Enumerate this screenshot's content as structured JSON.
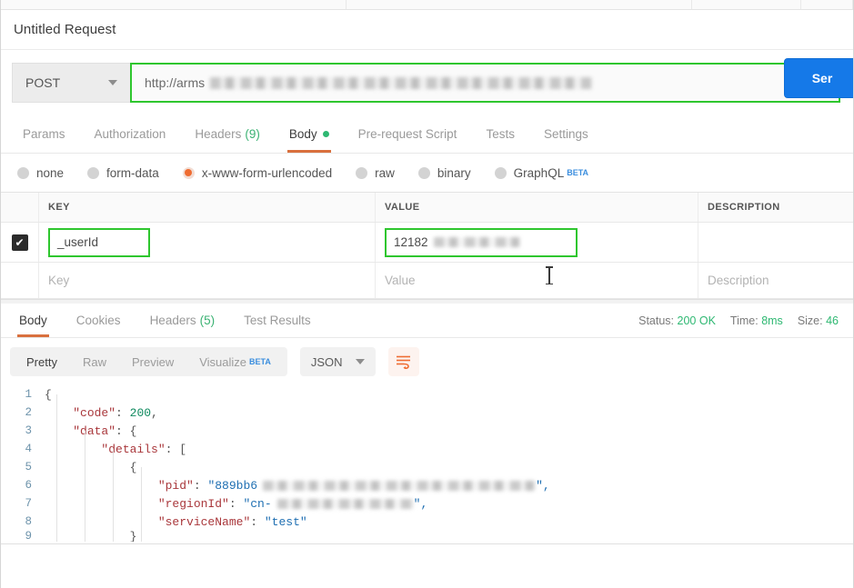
{
  "window": {
    "request_title": "Untitled Request"
  },
  "url_bar": {
    "method": "POST",
    "method_caret_icon": "chevron-down-icon",
    "url_value": "http://arms",
    "url_redacted": true,
    "send_label": "Send",
    "send_label_visible": "Ser",
    "highlight_color": "#2ec62e",
    "send_color": "#1579e8"
  },
  "request_tabs": [
    {
      "label": "Params",
      "active": false
    },
    {
      "label": "Authorization",
      "active": false
    },
    {
      "label": "Headers",
      "count": "(9)",
      "active": false
    },
    {
      "label": "Body",
      "active": true,
      "dot": true
    },
    {
      "label": "Pre-request Script",
      "active": false
    },
    {
      "label": "Tests",
      "active": false
    },
    {
      "label": "Settings",
      "active": false
    }
  ],
  "body_types": [
    {
      "label": "none",
      "selected": false
    },
    {
      "label": "form-data",
      "selected": false
    },
    {
      "label": "x-www-form-urlencoded",
      "selected": true
    },
    {
      "label": "raw",
      "selected": false
    },
    {
      "label": "binary",
      "selected": false
    },
    {
      "label": "GraphQL",
      "selected": false,
      "badge": "BETA"
    }
  ],
  "kv_table": {
    "columns": [
      "KEY",
      "VALUE",
      "DESCRIPTION"
    ],
    "rows": [
      {
        "checked": true,
        "check_icon": "checkmark-icon",
        "key": "_userId",
        "value": "12182",
        "value_redacted": true,
        "description": ""
      }
    ],
    "placeholders": {
      "key": "Key",
      "value": "Value",
      "description": "Description"
    }
  },
  "response": {
    "tabs": [
      {
        "label": "Body",
        "active": true
      },
      {
        "label": "Cookies",
        "active": false
      },
      {
        "label": "Headers",
        "count": "(5)",
        "active": false
      },
      {
        "label": "Test Results",
        "active": false
      }
    ],
    "meta": {
      "status_label": "Status:",
      "status_value": "200 OK",
      "time_label": "Time:",
      "time_value": "8ms",
      "size_label": "Size:",
      "size_value": "46"
    },
    "viewer": {
      "modes": [
        {
          "label": "Pretty",
          "active": true
        },
        {
          "label": "Raw",
          "active": false
        },
        {
          "label": "Preview",
          "active": false
        },
        {
          "label": "Visualize",
          "active": false,
          "badge": "BETA"
        }
      ],
      "format": "JSON",
      "format_caret_icon": "chevron-down-icon",
      "wrap_icon": "word-wrap-icon"
    },
    "json_lines": [
      {
        "no": "1",
        "indent": 0,
        "parts": [
          {
            "t": "{",
            "c": "p"
          }
        ]
      },
      {
        "no": "2",
        "indent": 1,
        "parts": [
          {
            "t": "\"code\"",
            "c": "k"
          },
          {
            "t": ": ",
            "c": "p"
          },
          {
            "t": "200",
            "c": "n"
          },
          {
            "t": ",",
            "c": "p"
          }
        ]
      },
      {
        "no": "3",
        "indent": 1,
        "parts": [
          {
            "t": "\"data\"",
            "c": "k"
          },
          {
            "t": ": {",
            "c": "p"
          }
        ]
      },
      {
        "no": "4",
        "indent": 2,
        "parts": [
          {
            "t": "\"details\"",
            "c": "k"
          },
          {
            "t": ": [",
            "c": "p"
          }
        ]
      },
      {
        "no": "5",
        "indent": 3,
        "parts": [
          {
            "t": "{",
            "c": "p"
          }
        ]
      },
      {
        "no": "6",
        "indent": 4,
        "parts": [
          {
            "t": "\"pid\"",
            "c": "k"
          },
          {
            "t": ": ",
            "c": "p"
          },
          {
            "t": "\"889bb6",
            "c": "s"
          }
        ],
        "blur": "pid",
        "tail": "\","
      },
      {
        "no": "7",
        "indent": 4,
        "parts": [
          {
            "t": "\"regionId\"",
            "c": "k"
          },
          {
            "t": ": ",
            "c": "p"
          },
          {
            "t": "\"cn-",
            "c": "s"
          }
        ],
        "blur": "region",
        "tail": "\","
      },
      {
        "no": "8",
        "indent": 4,
        "parts": [
          {
            "t": "\"serviceName\"",
            "c": "k"
          },
          {
            "t": ": ",
            "c": "p"
          },
          {
            "t": "\"test\"",
            "c": "s"
          }
        ]
      },
      {
        "no": "9",
        "indent": 3,
        "parts": [
          {
            "t": "}",
            "c": "p"
          }
        ],
        "clipped": true
      }
    ]
  }
}
